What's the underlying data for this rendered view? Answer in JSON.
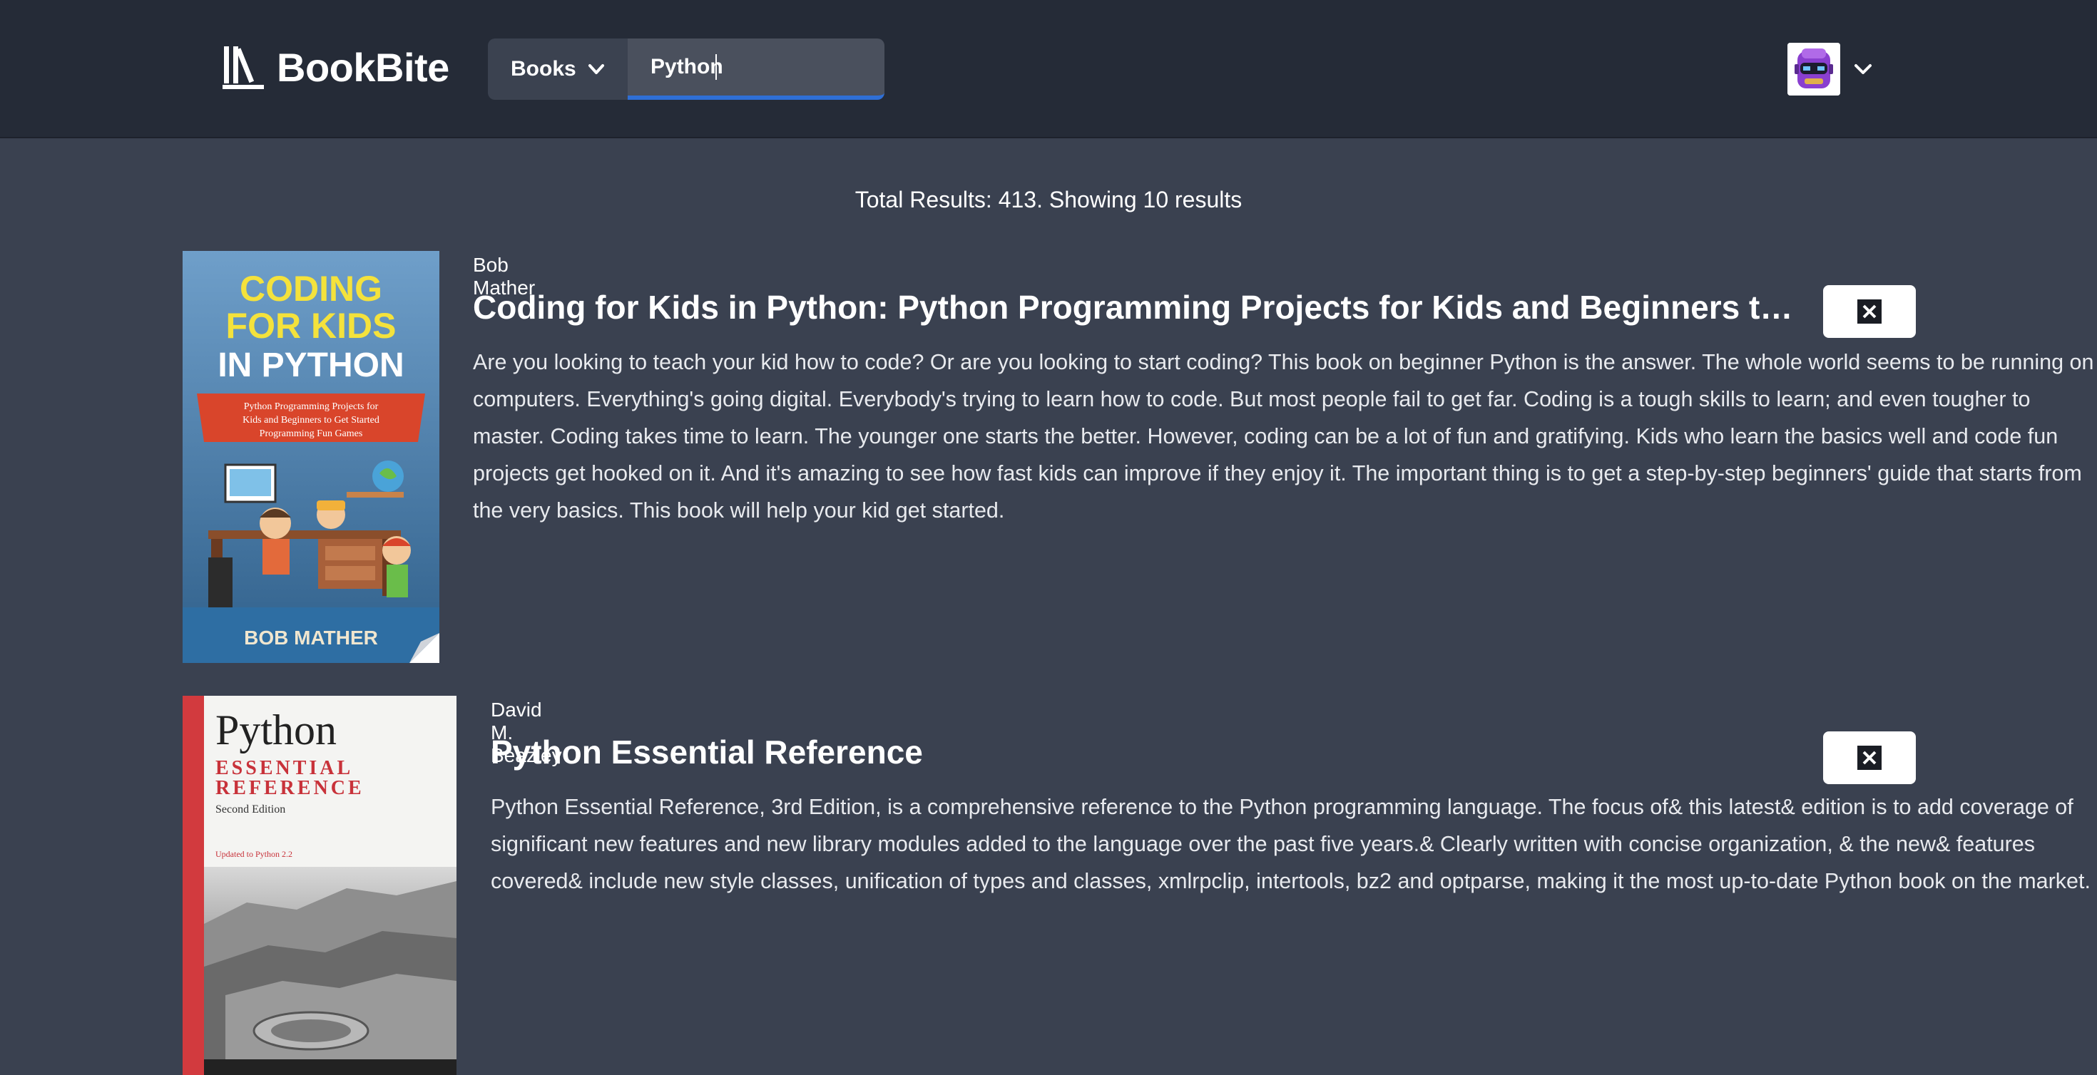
{
  "app": {
    "brand": "BookBite"
  },
  "search": {
    "category_label": "Books",
    "query": "Python"
  },
  "results": {
    "summary": "Total Results: 413. Showing 10 results",
    "items": [
      {
        "author": "Bob Mather",
        "title": "Coding for Kids in Python: Python Programming Projects for Kids and Beginners to Get Started Programming Fun Games",
        "description": "Are you looking to teach your kid how to code? Or are you looking to start coding? This book on beginner Python is the answer. The whole world seems to be running on computers. Everything's going digital. Everybody's trying to learn how to code. But most people fail to get far. Coding is a tough skills to learn; and even tougher to master. Coding takes time to learn. The younger one starts the better. However, coding can be a lot of fun and gratifying. Kids who learn the basics well and code fun projects get hooked on it. And it's amazing to see how fast kids can improve if they enjoy it. The important thing is to get a step-by-step beginners' guide that starts from the very basics. This book will help your kid get started.",
        "cover": {
          "line1": "CODING",
          "line2": "FOR KIDS",
          "line3": "IN PYTHON",
          "banner1": "Python Programming Projects for",
          "banner2": "Kids and Beginners to Get Started",
          "banner3": "Programming Fun Games",
          "author": "BOB MATHER"
        }
      },
      {
        "author": "David M. Beazley",
        "title": "Python Essential Reference",
        "description": "Python Essential Reference, 3rd Edition, is a comprehensive reference to the Python programming language. The focus of& this latest& edition is to add coverage of significant new features and new library modules added to the language over the past five years.& Clearly written with concise organization, & the new& features covered& include new style classes, unification of types and classes, xmlrpclip, intertools, bz2 and optparse, making it the most up-to-date Python book on the market.",
        "cover": {
          "line1": "Python",
          "line2": "ESSENTIAL",
          "line3": "REFERENCE",
          "edition": "Second Edition",
          "note": "Updated to Python 2.2"
        }
      }
    ]
  },
  "colors": {
    "header_bg": "#252b37",
    "page_bg": "#3a4150",
    "search_accent": "#2f6fd6"
  },
  "icons": {
    "logo": "library-books-icon",
    "dropdown": "chevron-down-icon",
    "close": "close-x-icon",
    "avatar": "robot-avatar-icon"
  }
}
